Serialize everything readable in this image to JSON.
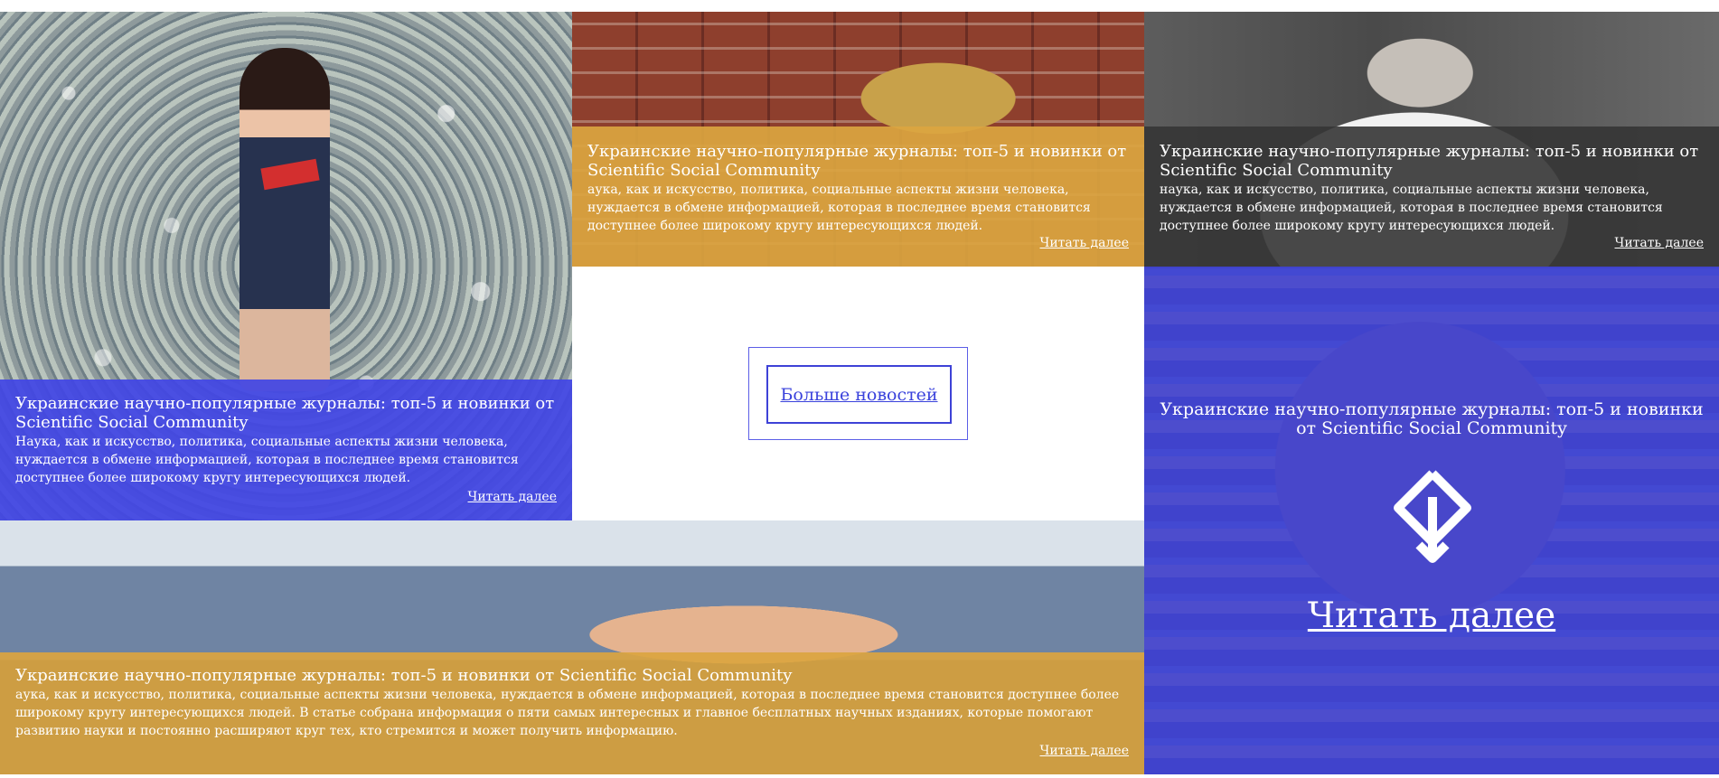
{
  "cards": [
    {
      "title": "Украинские научно-популярные журналы: топ-5 и новинки от Scientific Social Community",
      "text": "Наука, как и искусство, политика, социальные аспекты жизни человека, нуждается в обмене информацией, которая в последнее время становится доступнее более широкому кругу интересующихся людей.",
      "read_more": "Читать далее"
    },
    {
      "title": "Украинские научно-популярные журналы: топ-5 и новинки от Scientific Social Community",
      "text": "аука, как и искусство, политика, социальные аспекты жизни человека, нуждается в обмене информацией, которая в последнее время становится доступнее более широкому кругу интересующихся людей.",
      "read_more": "Читать далее"
    },
    {
      "title": "Украинские научно-популярные журналы: топ-5 и новинки от Scientific Social Community",
      "text": "наука, как и искусство, политика, социальные аспекты жизни человека, нуждается в обмене информацией, которая в последнее время становится доступнее более широкому кругу интересующихся людей.",
      "read_more": "Читать далее"
    },
    {
      "title": "Украинские научно-популярные журналы: топ-5 и новинки от Scientific Social Community",
      "text": "аука, как и искусство, политика, социальные аспекты жизни человека, нуждается в обмене информацией, которая в последнее время становится доступнее более широкому кругу интересующихся людей. В статье собрана информация о пяти самых интересных и главное бесплатных научных изданиях, которые помогают развитию науки и постоянно расширяют круг тех, кто стремится и может получить информацию.",
      "read_more": "Читать далее"
    }
  ],
  "more_news": "Больше новостей",
  "featured": {
    "title": "Украинские научно-популярные журналы: топ-5 и новинки от Scientific Social Community",
    "read_more": "Читать далее",
    "icon": "arrow-down-icon"
  },
  "colors": {
    "blue_overlay": "#4246e4",
    "orange_overlay": "#dba540",
    "dark_overlay": "#353535"
  }
}
